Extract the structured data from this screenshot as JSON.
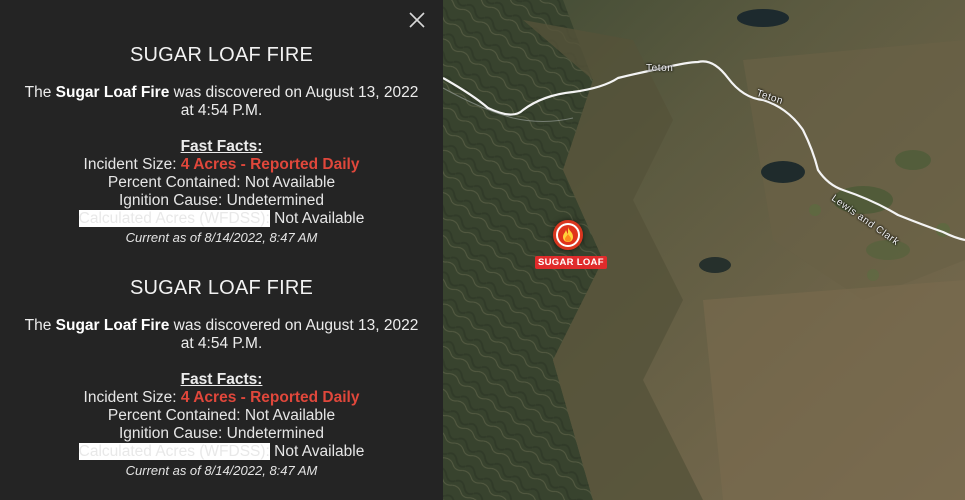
{
  "popup": {
    "close_icon": "close-icon",
    "entries": [
      {
        "title": "SUGAR LOAF FIRE",
        "discovered_prefix": "The ",
        "fire_name": "Sugar Loaf Fire",
        "discovered_suffix": " was discovered on August 13, 2022 at 4:54 P.M.",
        "fast_facts_heading": "Fast Facts:",
        "incident_size_label": "Incident Size: ",
        "incident_size_value": "4 Acres - Reported Daily",
        "percent_contained": "Percent Contained: Not Available",
        "ignition_cause": "Ignition Cause: Undetermined",
        "calculated_acres_label": "Calculated Acres (WFDSS):",
        "calculated_acres_value": " Not Available",
        "current_as_of": "Current as of 8/14/2022, 8:47 AM"
      },
      {
        "title": "SUGAR LOAF FIRE",
        "discovered_prefix": "The ",
        "fire_name": "Sugar Loaf Fire",
        "discovered_suffix": " was discovered on August 13, 2022 at 4:54 P.M.",
        "fast_facts_heading": "Fast Facts:",
        "incident_size_label": "Incident Size: ",
        "incident_size_value": "4 Acres - Reported Daily",
        "percent_contained": "Percent Contained: Not Available",
        "ignition_cause": "Ignition Cause: Undetermined",
        "calculated_acres_label": "Calculated Acres (WFDSS):",
        "calculated_acres_value": " Not Available",
        "current_as_of": "Current as of 8/14/2022, 8:47 AM"
      }
    ]
  },
  "map": {
    "labels": {
      "teton_1": "Teton",
      "teton_2": "Teton",
      "lewis_and_clark": "Lewis and Clark"
    },
    "fire_marker": {
      "icon": "fire-icon",
      "label": "SUGAR LOAF"
    },
    "colors": {
      "fire_red": "#e0341c",
      "fact_red": "#e0473b",
      "panel_bg": "#242424"
    }
  }
}
